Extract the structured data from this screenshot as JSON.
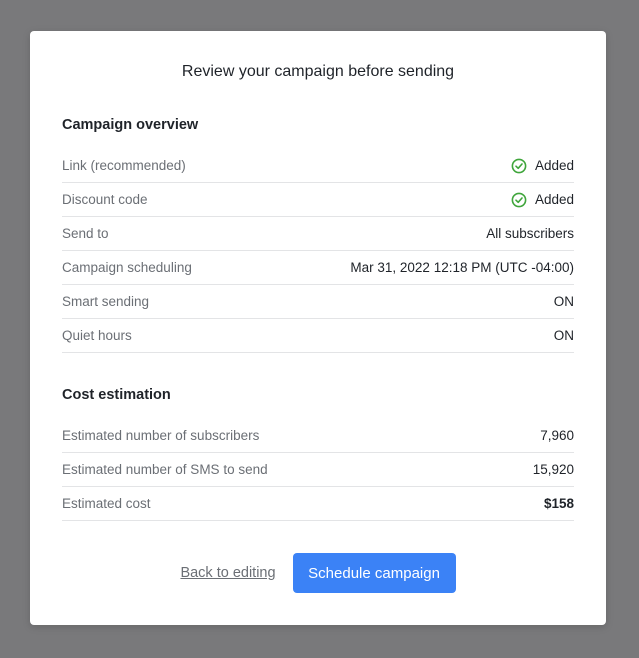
{
  "modal": {
    "title": "Review your campaign before sending"
  },
  "overview": {
    "title": "Campaign overview",
    "rows": [
      {
        "label": "Link (recommended)",
        "value": "Added",
        "status": "added"
      },
      {
        "label": "Discount code",
        "value": "Added",
        "status": "added"
      },
      {
        "label": "Send to",
        "value": "All subscribers"
      },
      {
        "label": "Campaign scheduling",
        "value": "Mar 31, 2022 12:18 PM (UTC -04:00)"
      },
      {
        "label": "Smart sending",
        "value": "ON"
      },
      {
        "label": "Quiet hours",
        "value": "ON"
      }
    ]
  },
  "cost": {
    "title": "Cost estimation",
    "rows": [
      {
        "label": "Estimated number of subscribers",
        "value": "7,960"
      },
      {
        "label": "Estimated number of SMS to send",
        "value": "15,920"
      },
      {
        "label": "Estimated cost",
        "value": "$158"
      }
    ]
  },
  "footer": {
    "back_label": "Back to editing",
    "primary_label": "Schedule campaign"
  },
  "colors": {
    "accent": "#3b82f6",
    "success": "#3fa53b",
    "overlay": "#79797b"
  },
  "icons": {
    "added": "check-circle-icon"
  }
}
